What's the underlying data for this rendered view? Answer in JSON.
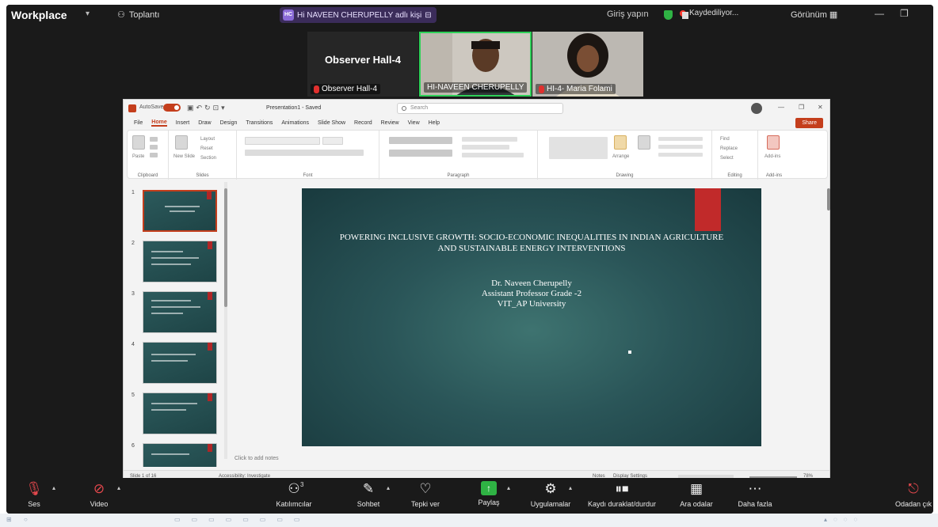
{
  "zoom": {
    "app_name": "Workplace",
    "meeting_label": "Toplantı",
    "share_badge": "HC",
    "share_label": "Hi NAVEEN CHERUPELLY adlı kişi",
    "sign_in": "Giriş yapın",
    "recording_label": "Kaydediliyor...",
    "view_label": "Görünüm",
    "participants": [
      {
        "name": "Observer Hall-4",
        "display_text": "Observer Hall-4"
      },
      {
        "name": "HI-NAVEEN CHERUPELLY"
      },
      {
        "name": "HI-4- Maria Folami"
      }
    ],
    "controls": [
      {
        "label": "Ses",
        "icon": "microphone-muted-icon"
      },
      {
        "label": "Video",
        "icon": "camera-off-icon"
      },
      {
        "label": "Katılımcılar",
        "icon": "participants-icon",
        "count": "3"
      },
      {
        "label": "Sohbet",
        "icon": "chat-icon"
      },
      {
        "label": "Tepki ver",
        "icon": "react-icon"
      },
      {
        "label": "Paylaş",
        "icon": "share-screen-icon"
      },
      {
        "label": "Uygulamalar",
        "icon": "apps-icon"
      },
      {
        "label": "Kaydı duraklat/durdur",
        "icon": "recording-controls-icon"
      },
      {
        "label": "Ara odalar",
        "icon": "breakout-rooms-icon"
      },
      {
        "label": "Daha fazla",
        "icon": "more-icon"
      },
      {
        "label": "Odadan çık",
        "icon": "leave-icon"
      }
    ]
  },
  "ppt": {
    "autosave": "AutoSave",
    "filename": "Presentation1 - Saved",
    "search_placeholder": "Search",
    "share_button": "Share",
    "menu": [
      "File",
      "Home",
      "Insert",
      "Draw",
      "Design",
      "Transitions",
      "Animations",
      "Slide Show",
      "Record",
      "Review",
      "View",
      "Help"
    ],
    "active_menu": "Home",
    "ribbon_groups": [
      "Clipboard",
      "Slides",
      "Font",
      "Paragraph",
      "Drawing",
      "Editing",
      "Add-ins"
    ],
    "ribbon_items": {
      "paste": "Paste",
      "new_slide": "New Slide",
      "layout": "Layout",
      "reset": "Reset",
      "section": "Section",
      "arrange": "Arrange",
      "find": "Find",
      "replace": "Replace",
      "select": "Select",
      "add_ins": "Add-ins"
    },
    "slide_numbers": [
      "1",
      "2",
      "3",
      "4",
      "5",
      "6"
    ],
    "slide": {
      "title": "POWERING INCLUSIVE GROWTH: SOCIO-ECONOMIC INEQUALITIES IN INDIAN AGRICULTURE AND SUSTAINABLE ENERGY INTERVENTIONS",
      "author": "Dr. Naveen Cherupelly",
      "position": "Assistant Professor Grade -2",
      "university": "VIT_AP University"
    },
    "notes_placeholder": "Click to add notes",
    "status": {
      "slide_of": "Slide 1 of 16",
      "accessibility": "Accessibility: Investigate",
      "notes": "Notes",
      "display_settings": "Display Settings",
      "zoom": "78%"
    }
  }
}
